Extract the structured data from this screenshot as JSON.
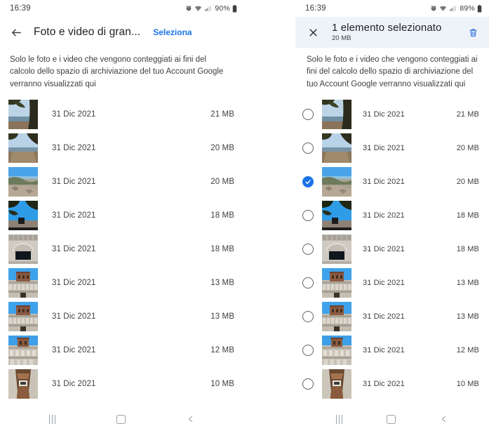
{
  "colors": {
    "accent": "#1a73e8",
    "selection_bar_bg": "#eef3fa",
    "text_primary": "#202124",
    "text_secondary": "#3c4043",
    "nav_icon": "#9aa0a6"
  },
  "left_screen": {
    "status_bar": {
      "clock": "16:39",
      "battery_percent": "90%",
      "icons": [
        "alarm-icon",
        "wifi-icon",
        "signal-icon",
        "battery-icon"
      ]
    },
    "app_bar": {
      "back_label": "back-arrow-icon",
      "title": "Foto e video di gran...",
      "select_label": "Seleziona"
    },
    "description": "Solo le foto e i video che vengono conteggiati ai fini del calcolo dello spazio di archiviazione del tuo Account Google verranno visualizzati qui",
    "items": [
      {
        "date": "31 Dic 2021",
        "size": "21 MB",
        "thumb": "tree-sea",
        "selected": false
      },
      {
        "date": "31 Dic 2021",
        "size": "20 MB",
        "thumb": "tree-path",
        "selected": false
      },
      {
        "date": "31 Dic 2021",
        "size": "20 MB",
        "thumb": "coast-view",
        "selected": false
      },
      {
        "date": "31 Dic 2021",
        "size": "18 MB",
        "thumb": "tree-bench",
        "selected": false
      },
      {
        "date": "31 Dic 2021",
        "size": "18 MB",
        "thumb": "stone-arch",
        "selected": false
      },
      {
        "date": "31 Dic 2021",
        "size": "13 MB",
        "thumb": "tower-a",
        "selected": false
      },
      {
        "date": "31 Dic 2021",
        "size": "13 MB",
        "thumb": "tower-b",
        "selected": false
      },
      {
        "date": "31 Dic 2021",
        "size": "12 MB",
        "thumb": "facade",
        "selected": false
      },
      {
        "date": "31 Dic 2021",
        "size": "10 MB",
        "thumb": "arch-detail",
        "selected": false
      }
    ],
    "nav_bar": {
      "recents": "recents-icon",
      "home": "home-icon",
      "back": "back-icon"
    }
  },
  "right_screen": {
    "status_bar": {
      "clock": "16:39",
      "battery_percent": "89%",
      "icons": [
        "alarm-icon",
        "wifi-icon",
        "signal-icon",
        "battery-icon"
      ]
    },
    "selection_bar": {
      "close_label": "close-icon",
      "title": "1 elemento selezionato",
      "subtitle": "20 MB",
      "delete_label": "delete-icon"
    },
    "description": "Solo le foto e i video che vengono conteggiati ai fini del calcolo dello spazio di archiviazione del tuo Account Google verranno visualizzati qui",
    "items": [
      {
        "date": "31 Dic 2021",
        "size": "21 MB",
        "thumb": "tree-sea",
        "selected": false
      },
      {
        "date": "31 Dic 2021",
        "size": "20 MB",
        "thumb": "tree-path",
        "selected": false
      },
      {
        "date": "31 Dic 2021",
        "size": "20 MB",
        "thumb": "coast-view",
        "selected": true
      },
      {
        "date": "31 Dic 2021",
        "size": "18 MB",
        "thumb": "tree-bench",
        "selected": false
      },
      {
        "date": "31 Dic 2021",
        "size": "18 MB",
        "thumb": "stone-arch",
        "selected": false
      },
      {
        "date": "31 Dic 2021",
        "size": "13 MB",
        "thumb": "tower-a",
        "selected": false
      },
      {
        "date": "31 Dic 2021",
        "size": "13 MB",
        "thumb": "tower-b",
        "selected": false
      },
      {
        "date": "31 Dic 2021",
        "size": "12 MB",
        "thumb": "facade",
        "selected": false
      },
      {
        "date": "31 Dic 2021",
        "size": "10 MB",
        "thumb": "arch-detail",
        "selected": false
      }
    ],
    "nav_bar": {
      "recents": "recents-icon",
      "home": "home-icon",
      "back": "back-icon"
    }
  }
}
